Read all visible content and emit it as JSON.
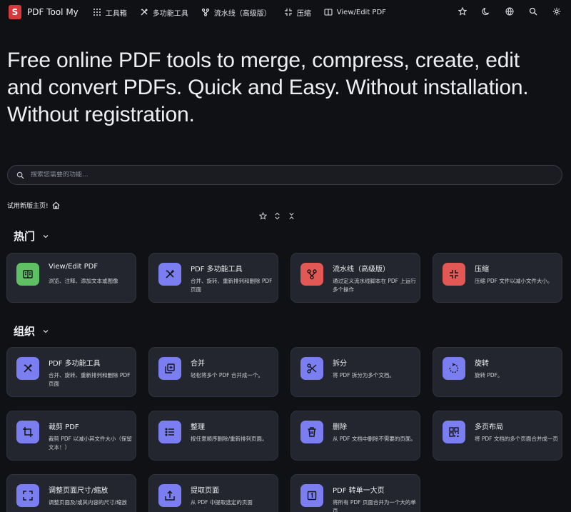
{
  "brand": {
    "name": "PDF Tool My",
    "logo_letter": "S"
  },
  "nav": {
    "items": [
      {
        "label": "工具箱",
        "icon": "grid-icon"
      },
      {
        "label": "多功能工具",
        "icon": "tools-icon"
      },
      {
        "label": "流水线（高级版）",
        "icon": "pipeline-icon"
      },
      {
        "label": "压缩",
        "icon": "compress-icon"
      },
      {
        "label": "View/Edit PDF",
        "icon": "book-icon"
      }
    ],
    "right_icons": [
      "star-icon",
      "moon-icon",
      "globe-icon",
      "search-icon",
      "gear-icon"
    ]
  },
  "hero": {
    "line1": "Free online PDF tools to merge, compress, create, edit",
    "line2": "and convert PDFs. Quick and Easy. Without installation.",
    "line3": "Without registration."
  },
  "search": {
    "placeholder": "搜索您需要的功能...",
    "value": ""
  },
  "try_new": {
    "label": "试用新版主页!"
  },
  "sections": {
    "popular": {
      "title": "热门"
    },
    "organize": {
      "title": "组织"
    }
  },
  "popular_cards": [
    {
      "title": "View/Edit PDF",
      "desc": "浏览、注释、添加文本或图像",
      "color": "#5fbf63",
      "icon": "book-icon"
    },
    {
      "title": "PDF 多功能工具",
      "desc": "合并、旋转、重新排列和删除 PDF 页面",
      "color": "#7a7ef0",
      "icon": "tools-icon"
    },
    {
      "title": "流水线（高级版）",
      "desc": "通过定义流水线脚本在 PDF 上运行多个操作",
      "color": "#e25855",
      "icon": "pipeline-icon"
    },
    {
      "title": "压缩",
      "desc": "压缩 PDF 文件以减小文件大小。",
      "color": "#e25855",
      "icon": "compress-icon"
    }
  ],
  "organize_cards": [
    {
      "title": "PDF 多功能工具",
      "desc": "合并、旋转、重新排列和删除 PDF 页面",
      "color": "#7a7ef0",
      "icon": "tools-icon"
    },
    {
      "title": "合并",
      "desc": "轻松将多个 PDF 合并成一个。",
      "color": "#7a7ef0",
      "icon": "merge-icon"
    },
    {
      "title": "拆分",
      "desc": "将 PDF 拆分为多个文档。",
      "color": "#7a7ef0",
      "icon": "scissors-icon"
    },
    {
      "title": "旋转",
      "desc": "旋转 PDF。",
      "color": "#7a7ef0",
      "icon": "rotate-icon"
    },
    {
      "title": "裁剪 PDF",
      "desc": "裁剪 PDF 以减小其文件大小（保留文本！）",
      "color": "#7a7ef0",
      "icon": "crop-icon"
    },
    {
      "title": "整理",
      "desc": "按任意顺序删除/重新排列页面。",
      "color": "#7a7ef0",
      "icon": "list-icon"
    },
    {
      "title": "删除",
      "desc": "从 PDF 文档中删除不需要的页面。",
      "color": "#7a7ef0",
      "icon": "trash-icon"
    },
    {
      "title": "多页布局",
      "desc": "将 PDF 文档的多个页面合并成一页",
      "color": "#7a7ef0",
      "icon": "layout-icon"
    },
    {
      "title": "调整页面尺寸/缩放",
      "desc": "调整页面及/或其内容的尺寸/缩放",
      "color": "#7a7ef0",
      "icon": "scale-icon"
    },
    {
      "title": "提取页面",
      "desc": "从 PDF 中提取选定的页面",
      "color": "#7a7ef0",
      "icon": "extract-icon"
    },
    {
      "title": "PDF 转单一大页",
      "desc": "将所有 PDF 页面合并为一个大的单页",
      "color": "#7a7ef0",
      "icon": "single-page-icon"
    }
  ]
}
